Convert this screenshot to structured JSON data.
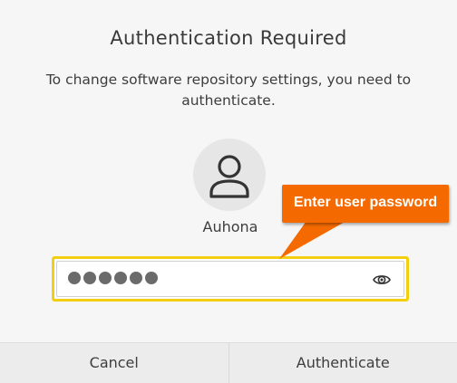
{
  "dialog": {
    "title": "Authentication Required",
    "message": "To change software repository settings, you need to authenticate.",
    "user": {
      "avatar_icon": "user-icon",
      "name": "Auhona"
    },
    "password": {
      "masked_length": 6,
      "reveal_icon": "eye-icon"
    },
    "buttons": {
      "cancel": "Cancel",
      "authenticate": "Authenticate"
    }
  },
  "annotation": {
    "callout_text": "Enter user password",
    "callout_color": "#f56a00",
    "highlight_color": "#f2cf10"
  }
}
